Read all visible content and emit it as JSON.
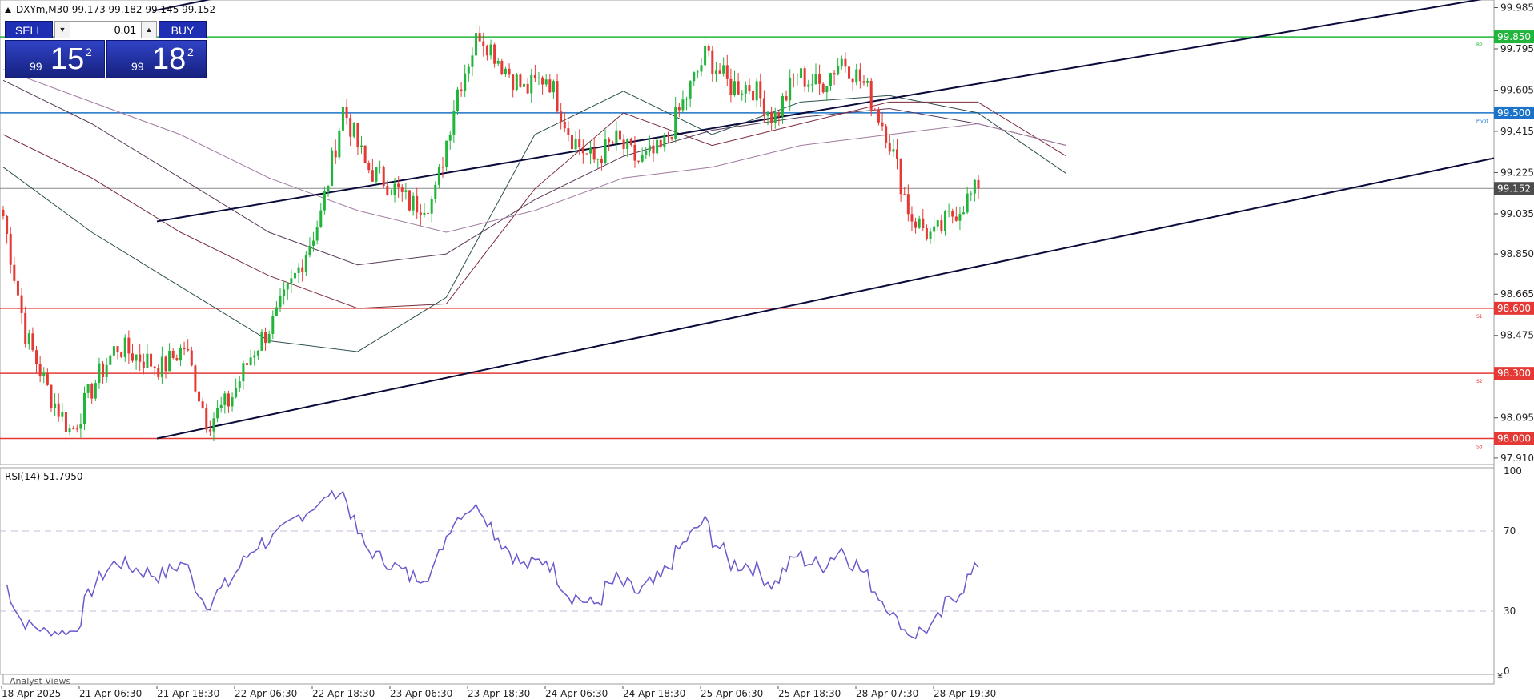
{
  "symbol_header": "DXYm,M30  99.173 99.182 99.145 99.152",
  "trade_panel": {
    "sell_label": "SELL",
    "buy_label": "BUY",
    "lot_value": "0.01",
    "sell_price": {
      "small": "99",
      "big": "15",
      "sup": "2"
    },
    "buy_price": {
      "small": "99",
      "big": "18",
      "sup": "2"
    }
  },
  "price_axis": {
    "ticks": [
      "99.985",
      "99.795",
      "99.605",
      "99.415",
      "99.225",
      "99.035",
      "98.850",
      "98.665",
      "98.475",
      "98.285",
      "98.095",
      "97.910"
    ],
    "current_price": "99.152"
  },
  "levels": [
    {
      "label": "99.850",
      "tag": "R2",
      "value": 99.85,
      "color": "#21b53b"
    },
    {
      "label": "99.500",
      "tag": "Pivot",
      "value": 99.5,
      "color": "#1a73c8"
    },
    {
      "label": "98.600",
      "tag": "S1",
      "value": 98.6,
      "color": "#e53935"
    },
    {
      "label": "98.300",
      "tag": "S2",
      "value": 98.3,
      "color": "#e53935"
    },
    {
      "label": "98.000",
      "tag": "S3",
      "value": 98.0,
      "color": "#e53935"
    }
  ],
  "rsi": {
    "label": "RSI(14) 51.7950",
    "ticks": [
      "100",
      "70",
      "30",
      "0"
    ],
    "value": 51.795,
    "levels": [
      70,
      30
    ],
    "color": "#6a5acd"
  },
  "time_axis": {
    "labels": [
      "18 Apr 2025",
      "21 Apr 06:30",
      "21 Apr 18:30",
      "22 Apr 06:30",
      "22 Apr 18:30",
      "23 Apr 06:30",
      "23 Apr 18:30",
      "24 Apr 06:30",
      "24 Apr 18:30",
      "25 Apr 06:30",
      "25 Apr 18:30",
      "28 Apr 07:30",
      "28 Apr 19:30"
    ]
  },
  "analyst_views_label": "Analyst Views",
  "colors": {
    "bull_candle": "#21b53b",
    "bear_candle": "#e53935",
    "trendline": "#0b0b3b",
    "current_price_box": "#4d4d4d",
    "panel_blue": "#1f2fb3"
  },
  "chart_data": {
    "type": "candlestick",
    "timeframe": "M30",
    "ylim": [
      97.88,
      100.02
    ],
    "x_range": [
      "18 Apr 2025",
      "28 Apr 19:30"
    ],
    "anchors": [
      [
        98.9,
        99.15
      ],
      [
        98.4,
        98.55
      ],
      [
        98.18,
        98.25
      ],
      [
        97.95,
        98.1
      ],
      [
        98.3,
        98.2
      ],
      [
        98.4,
        98.45
      ],
      [
        98.35,
        98.4
      ],
      [
        98.3,
        98.35
      ],
      [
        98.45,
        98.4
      ],
      [
        98.1,
        98.05
      ],
      [
        98.0,
        98.35
      ],
      [
        98.35,
        98.45
      ],
      [
        98.5,
        98.6
      ],
      [
        98.7,
        98.85
      ],
      [
        99.0,
        99.05
      ],
      [
        99.25,
        99.8
      ],
      [
        99.4,
        99.1
      ],
      [
        99.2,
        99.15
      ],
      [
        99.1,
        99.05
      ],
      [
        99.0,
        99.2
      ],
      [
        99.5,
        99.7
      ],
      [
        99.85,
        99.9
      ],
      [
        99.75,
        99.7
      ],
      [
        99.65,
        99.55
      ],
      [
        99.7,
        99.65
      ],
      [
        99.45,
        99.35
      ],
      [
        99.3,
        99.25
      ],
      [
        99.4,
        99.35
      ],
      [
        99.3,
        99.25
      ],
      [
        99.3,
        99.35
      ],
      [
        99.5,
        99.6
      ],
      [
        99.8,
        99.75
      ],
      [
        99.65,
        99.6
      ],
      [
        99.7,
        99.55
      ],
      [
        99.5,
        99.45
      ],
      [
        99.6,
        99.75
      ],
      [
        99.7,
        99.55
      ],
      [
        99.8,
        99.7
      ],
      [
        99.65,
        99.6
      ],
      [
        99.45,
        99.35
      ],
      [
        99.05,
        99.0
      ],
      [
        98.95,
        98.9
      ],
      [
        99.0,
        99.1
      ],
      [
        99.15,
        99.152
      ]
    ],
    "moving_averages": [
      {
        "values": [
          99.65,
          99.45,
          99.2,
          98.95,
          98.8,
          98.85,
          99.1,
          99.3,
          99.42,
          99.48,
          99.52,
          99.45,
          99.35
        ]
      },
      {
        "values": [
          99.4,
          99.2,
          98.95,
          98.75,
          98.6,
          98.62,
          99.15,
          99.5,
          99.35,
          99.45,
          99.55,
          99.55,
          99.3
        ]
      },
      {
        "values": [
          99.25,
          98.95,
          98.7,
          98.45,
          98.4,
          98.65,
          99.4,
          99.6,
          99.4,
          99.55,
          99.58,
          99.5,
          99.22
        ]
      },
      {
        "values": [
          99.7,
          99.55,
          99.4,
          99.2,
          99.05,
          98.95,
          99.05,
          99.2,
          99.25,
          99.35,
          99.4,
          99.45,
          99.35
        ]
      }
    ],
    "trendlines": [
      {
        "from": [
          "21 Apr 18:30",
          99.0
        ],
        "to": [
          "28 Apr 19:30",
          99.6
        ]
      },
      {
        "from": [
          "21 Apr 18:30",
          98.0
        ],
        "to": [
          "28 Apr 19:30",
          98.75
        ]
      }
    ]
  }
}
